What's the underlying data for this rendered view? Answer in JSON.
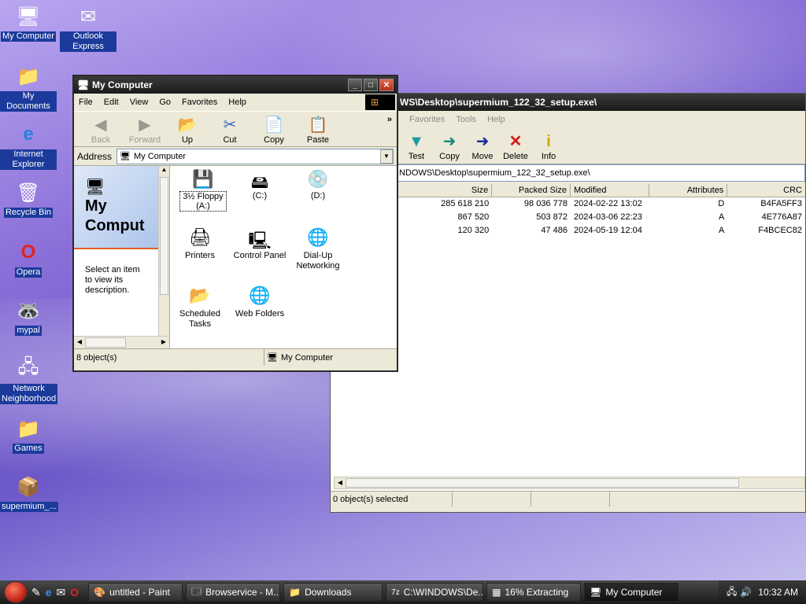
{
  "desktop_icons": [
    {
      "label": "My Computer"
    },
    {
      "label": "Outlook Express"
    },
    {
      "label": "My Documents"
    },
    {
      "label": "Internet Explorer"
    },
    {
      "label": "Recycle Bin"
    },
    {
      "label": "Opera"
    },
    {
      "label": "mypal"
    },
    {
      "label": "Network Neighborhood"
    },
    {
      "label": "Games"
    },
    {
      "label": "supermium_..."
    }
  ],
  "explorer": {
    "title": "My Computer",
    "menu": [
      "File",
      "Edit",
      "View",
      "Go",
      "Favorites",
      "Help"
    ],
    "toolbar": [
      "Back",
      "Forward",
      "Up",
      "Cut",
      "Copy",
      "Paste"
    ],
    "address_label": "Address",
    "address_value": "My Computer",
    "left_title": "My Comput",
    "left_desc": "Select an item to view its description.",
    "items": [
      {
        "label": "3½ Floppy (A:)"
      },
      {
        "label": "(C:)"
      },
      {
        "label": "(D:)"
      },
      {
        "label": "Printers"
      },
      {
        "label": "Control Panel"
      },
      {
        "label": "Dial-Up Networking"
      },
      {
        "label": "Scheduled Tasks"
      },
      {
        "label": "Web Folders"
      }
    ],
    "status_left": "8 object(s)",
    "status_right": "My Computer"
  },
  "zip": {
    "title": "WS\\Desktop\\supermium_122_32_setup.exe\\",
    "menu": [
      "Favorites",
      "Tools",
      "Help"
    ],
    "toolbar": [
      "Test",
      "Copy",
      "Move",
      "Delete",
      "Info"
    ],
    "path": "NDOWS\\Desktop\\supermium_122_32_setup.exe\\",
    "columns": [
      "Size",
      "Packed Size",
      "Modified",
      "Attributes",
      "CRC"
    ],
    "rows": [
      {
        "size": "285 618 210",
        "packed": "98 036 778",
        "modified": "2024-02-22 13:02",
        "attr": "D",
        "crc": "B4FA5FF3"
      },
      {
        "size": "867 520",
        "packed": "503 872",
        "modified": "2024-03-06 22:23",
        "attr": "A",
        "crc": "4E776A87"
      },
      {
        "size": "120 320",
        "packed": "47 486",
        "modified": "2024-05-19 12:04",
        "attr": "A",
        "crc": "F4BCEC82"
      }
    ],
    "status": "0 object(s) selected"
  },
  "taskbar": {
    "tasks": [
      "untitled - Paint",
      "Browservice - M...",
      "Downloads",
      "C:\\WINDOWS\\De...",
      "16% Extracting",
      "My Computer"
    ],
    "clock": "10:32 AM"
  }
}
